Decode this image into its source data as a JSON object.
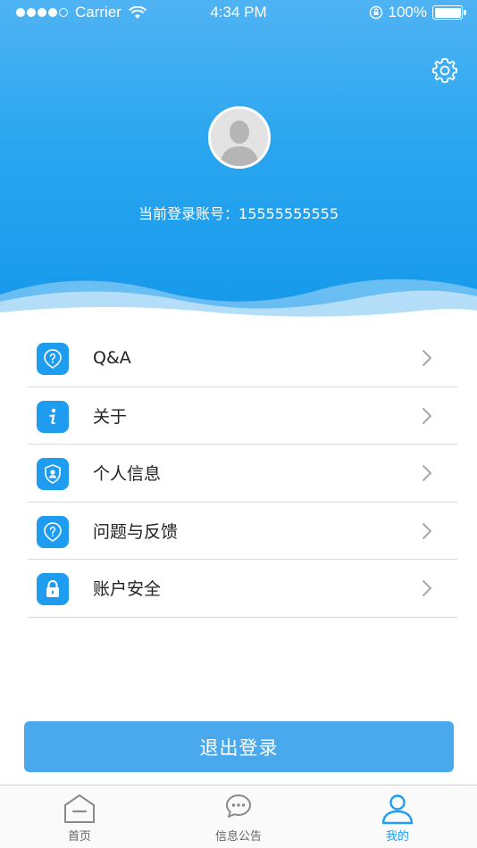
{
  "status_bar": {
    "carrier": "Carrier",
    "time": "4:34 PM",
    "battery": "100%"
  },
  "profile": {
    "account_label": "当前登录账号：",
    "account_number": "15555555555"
  },
  "menu": {
    "items": [
      {
        "label": "Q&A",
        "icon": "question-shield-icon"
      },
      {
        "label": "关于",
        "icon": "info-icon"
      },
      {
        "label": "个人信息",
        "icon": "person-shield-icon"
      },
      {
        "label": "问题与反馈",
        "icon": "question-shield-icon"
      },
      {
        "label": "账户安全",
        "icon": "lock-icon"
      }
    ]
  },
  "logout": {
    "label": "退出登录"
  },
  "tabbar": {
    "tabs": [
      {
        "label": "首页",
        "icon": "home-icon"
      },
      {
        "label": "信息公告",
        "icon": "chat-bubble-icon"
      },
      {
        "label": "我的",
        "icon": "person-icon",
        "active": true
      }
    ]
  },
  "colors": {
    "accent": "#1e9cf0",
    "header": "#2aa6f0",
    "logout": "#4aa9ec"
  }
}
